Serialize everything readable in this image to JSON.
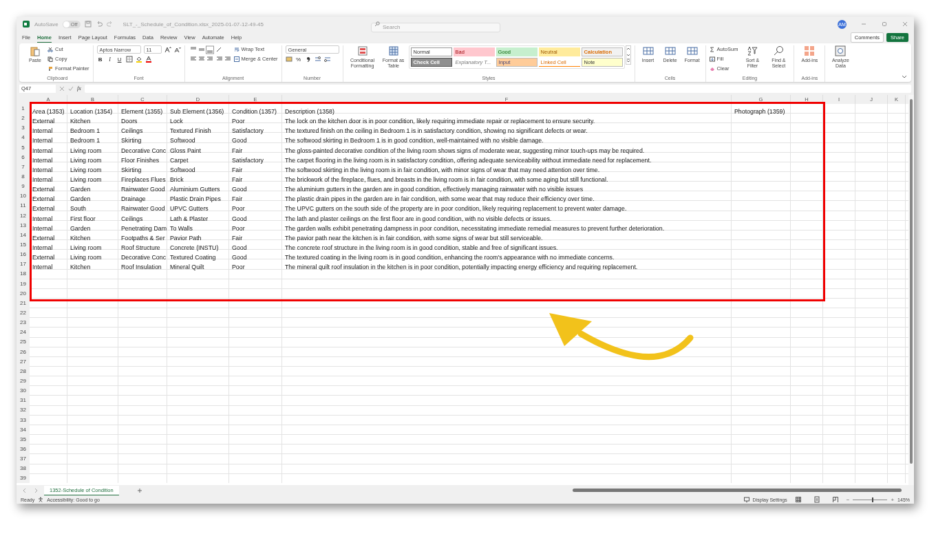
{
  "title_bar": {
    "autosave": {
      "label": "AutoSave",
      "on": false,
      "state": "Off"
    },
    "file_name": "SLT_-_Schedule_of_Condition.xlsx_2025-01-07-12-49-45",
    "search": {
      "placeholder": "Search"
    },
    "avatar": "AM"
  },
  "menu": [
    {
      "label": "File",
      "selected": false
    },
    {
      "label": "Home",
      "selected": true
    },
    {
      "label": "Insert",
      "selected": false
    },
    {
      "label": "Page Layout",
      "selected": false
    },
    {
      "label": "Formulas",
      "selected": false
    },
    {
      "label": "Data",
      "selected": false
    },
    {
      "label": "Review",
      "selected": false
    },
    {
      "label": "View",
      "selected": false
    },
    {
      "label": "Automate",
      "selected": false
    },
    {
      "label": "Help",
      "selected": false
    }
  ],
  "actions": {
    "comments": "Comments",
    "share": "Share"
  },
  "ribbon": {
    "clipboard": {
      "label": "Clipboard",
      "paste": "Paste",
      "cut": "Cut",
      "copy": "Copy",
      "format_painter": "Format Painter"
    },
    "font": {
      "label": "Font",
      "family": "Aptos Narrow",
      "size": "11",
      "bold": "B",
      "italic": "I",
      "underline": "U"
    },
    "alignment": {
      "label": "Alignment",
      "wrap": "Wrap Text",
      "merge": "Merge & Center"
    },
    "number": {
      "label": "Number",
      "format": "General",
      "percent": "%"
    },
    "styles": {
      "label": "Styles",
      "conditional": "Conditional Formatting",
      "format_table": "Format as Table",
      "cells": [
        {
          "label": "Normal",
          "kind": "normal"
        },
        {
          "label": "Bad",
          "kind": "bad"
        },
        {
          "label": "Good",
          "kind": "good"
        },
        {
          "label": "Neutral",
          "kind": "neutral"
        },
        {
          "label": "Calculation",
          "kind": "calculation"
        },
        {
          "label": "Check Cell",
          "kind": "check"
        },
        {
          "label": "Explanatory T...",
          "kind": "explanatory"
        },
        {
          "label": "Input",
          "kind": "input"
        },
        {
          "label": "Linked Cell",
          "kind": "linked"
        },
        {
          "label": "Note",
          "kind": "note"
        }
      ]
    },
    "cells": {
      "label": "Cells",
      "buttons": [
        "Insert",
        "Delete",
        "Format"
      ]
    },
    "editing": {
      "label": "Editing",
      "autosum": "AutoSum",
      "fill": "Fill",
      "clear": "Clear",
      "sort": "Sort & Filter",
      "find": "Find & Select"
    },
    "addins": {
      "label": "Add-ins",
      "button": "Add-ins"
    },
    "analyze": {
      "button": "Analyze Data"
    }
  },
  "formula_bar": {
    "name_box": "Q47",
    "fx": "fx"
  },
  "sheet": {
    "columns": [
      "A",
      "B",
      "C",
      "D",
      "E",
      "F",
      "G",
      "H",
      "I",
      "J",
      "K"
    ],
    "rows": [
      {
        "number": "1",
        "cells": [
          "Area (1353)",
          "Location (1354)",
          "Element (1355)",
          "Sub Element (1356)",
          "Condition (1357)",
          "Description (1358)",
          "Photograph (1359)"
        ]
      },
      {
        "number": "2",
        "cells": [
          "External",
          "Kitchen",
          "Doors",
          "Lock",
          "Poor",
          "The lock on the kitchen door is in poor condition, likely requiring immediate repair or replacement to ensure security."
        ]
      },
      {
        "number": "3",
        "cells": [
          "Internal",
          "Bedroom 1",
          "Ceilings",
          "Textured Finish",
          "Satisfactory",
          "The textured finish on the ceiling in Bedroom 1 is in satisfactory condition, showing no significant defects or wear."
        ]
      },
      {
        "number": "4",
        "cells": [
          "Internal",
          "Bedroom 1",
          "Skirting",
          "Softwood",
          "Good",
          "The softwood skirting in Bedroom 1 is in good condition, well-maintained with no visible damage."
        ]
      },
      {
        "number": "5",
        "cells": [
          "Internal",
          "Living room",
          "Decorative Conc",
          "Gloss Paint",
          "Fair",
          "The gloss-painted decorative condition of the living room shows signs of moderate wear, suggesting minor touch-ups may be required."
        ]
      },
      {
        "number": "6",
        "cells": [
          "Internal",
          "Living room",
          "Floor Finishes",
          "Carpet",
          "Satisfactory",
          "The carpet flooring in the living room is in satisfactory condition, offering adequate serviceability without immediate need for replacement."
        ]
      },
      {
        "number": "7",
        "cells": [
          "Internal",
          "Living room",
          "Skirting",
          "Softwood",
          "Fair",
          "The softwood skirting in the living room is in fair condition, with minor signs of wear that may need attention over time."
        ]
      },
      {
        "number": "8",
        "cells": [
          "Internal",
          "Living room",
          "Fireplaces Flues",
          "Brick",
          "Fair",
          "The brickwork of the fireplace, flues, and breasts in the living room is in fair condition, with some aging but still functional."
        ]
      },
      {
        "number": "9",
        "cells": [
          "External",
          "Garden",
          "Rainwater Good",
          "Aluminium Gutters",
          "Good",
          "The aluminium gutters in the garden are in good condition, effectively managing rainwater with no visible issues"
        ]
      },
      {
        "number": "10",
        "cells": [
          "External",
          "Garden",
          "Drainage",
          "Plastic Drain Pipes",
          "Fair",
          "The plastic drain pipes in the garden are in fair condition, with some wear that may reduce their efficiency over time."
        ]
      },
      {
        "number": "11",
        "cells": [
          "External",
          "South",
          "Rainwater Good",
          "UPVC Gutters",
          "Poor",
          "The UPVC gutters on the south side of the property are in poor condition, likely requiring replacement to prevent water damage."
        ]
      },
      {
        "number": "12",
        "cells": [
          "Internal",
          "First floor",
          "Ceilings",
          "Lath & Plaster",
          "Good",
          "The lath and plaster ceilings on the first floor are in good condition, with no visible defects or issues."
        ]
      },
      {
        "number": "13",
        "cells": [
          "Internal",
          "Garden",
          "Penetrating Dam",
          "To Walls",
          "Poor",
          "The garden walls exhibit penetrating dampness in poor condition, necessitating immediate remedial measures to prevent further deterioration."
        ]
      },
      {
        "number": "14",
        "cells": [
          "External",
          "Kitchen",
          "Footpaths & Ser",
          "Pavior Path",
          "Fair",
          "The pavior path near the kitchen is in fair condition, with some signs of wear but still serviceable."
        ]
      },
      {
        "number": "15",
        "cells": [
          "Internal",
          "Living room",
          "Roof Structure",
          "Concrete (INSTU)",
          "Good",
          "The concrete roof structure in the living room is in good condition, stable and free of significant issues."
        ]
      },
      {
        "number": "16",
        "cells": [
          "External",
          "Living room",
          "Decorative Conc",
          "Textured Coating",
          "Good",
          "The textured coating in the living room is in good condition, enhancing the room's appearance with no immediate concerns."
        ]
      },
      {
        "number": "17",
        "cells": [
          "Internal",
          "Kitchen",
          "Roof Insulation",
          "Mineral Quilt",
          "Poor",
          "The mineral quilt roof insulation in the kitchen is in poor condition, potentially impacting energy efficiency and requiring replacement."
        ]
      },
      {
        "number": "18"
      },
      {
        "number": "19"
      },
      {
        "number": "20"
      },
      {
        "number": "21"
      },
      {
        "number": "22"
      },
      {
        "number": "23"
      },
      {
        "number": "24"
      },
      {
        "number": "25"
      },
      {
        "number": "26"
      },
      {
        "number": "27"
      },
      {
        "number": "28"
      },
      {
        "number": "29"
      },
      {
        "number": "30"
      },
      {
        "number": "31"
      },
      {
        "number": "32"
      },
      {
        "number": "33"
      },
      {
        "number": "34"
      },
      {
        "number": "35"
      },
      {
        "number": "36"
      },
      {
        "number": "37"
      },
      {
        "number": "38"
      },
      {
        "number": "39"
      }
    ]
  },
  "sheet_tabs": [
    {
      "label": "1352-Schedule of Condition",
      "selected": true
    }
  ],
  "status_bar": {
    "mode": "Ready",
    "accessibility": "Accessibility: Good to go",
    "display_settings": "Display Settings",
    "zoom_out": "−",
    "zoom_slider": {
      "level": 0.55
    },
    "zoom_in": "+",
    "zoom": "145%"
  }
}
